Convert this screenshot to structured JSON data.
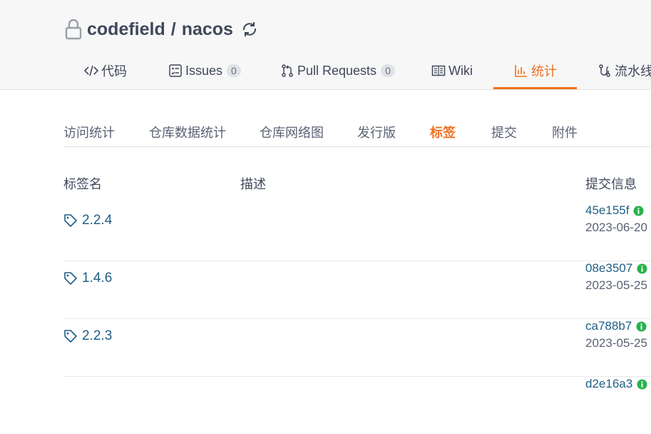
{
  "repo": {
    "owner": "codefield",
    "separator": "/",
    "name": "nacos"
  },
  "nav_tabs": [
    {
      "label": "代码",
      "icon": "code-icon"
    },
    {
      "label": "Issues",
      "count": "0",
      "icon": "issues-icon"
    },
    {
      "label": "Pull Requests",
      "count": "0",
      "icon": "pull-request-icon"
    },
    {
      "label": "Wiki",
      "icon": "wiki-icon"
    },
    {
      "label": "统计",
      "icon": "stats-icon",
      "active": true
    },
    {
      "label": "流水线",
      "icon": "pipeline-icon"
    }
  ],
  "sub_nav": [
    {
      "label": "访问统计"
    },
    {
      "label": "仓库数据统计"
    },
    {
      "label": "仓库网络图"
    },
    {
      "label": "发行版"
    },
    {
      "label": "标签",
      "active": true
    },
    {
      "label": "提交"
    },
    {
      "label": "附件"
    }
  ],
  "table": {
    "headers": {
      "tag_name": "标签名",
      "description": "描述",
      "commit_info": "提交信息"
    },
    "rows": [
      {
        "tag": "2.2.4",
        "commit": "45e155f",
        "date": "2023-06-20"
      },
      {
        "tag": "1.4.6",
        "commit": "08e3507",
        "date": "2023-05-25"
      },
      {
        "tag": "2.2.3",
        "commit": "ca788b7",
        "date": "2023-05-25"
      },
      {
        "tag": "",
        "commit": "d2e16a3",
        "date": ""
      }
    ]
  },
  "colors": {
    "accent": "#f07021",
    "link": "#1f5f86",
    "verified": "#2ab24c"
  }
}
